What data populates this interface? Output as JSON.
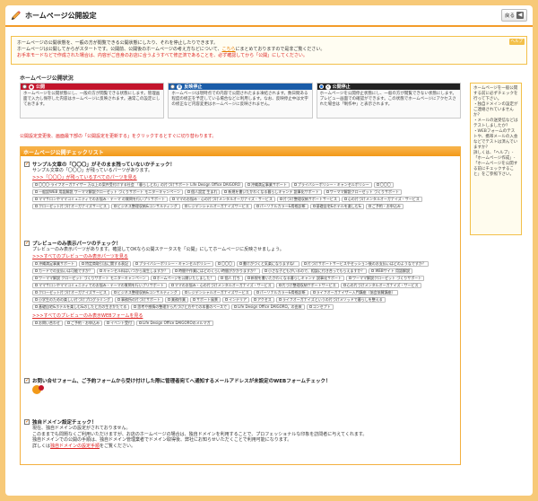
{
  "header": {
    "title": "ホームページ公開設定",
    "back_label": "戻る"
  },
  "info": {
    "line1": "ホームページの公開状態を、一般の方が閲覧できる公開状態にしたり、それを停止したりできます。",
    "line2_before": "ホームページは公開してからがスタートです。公開前、公開後のホームページの考え方などについて、",
    "line2_link": "こちら",
    "line2_after": "にまとめておりますので是非ご覧ください。",
    "line3": "お手本モードなどで作成された場合は、内容がご自身のお店に合うようすべて修正済であることを、必ず確認してから「公開」にしてください。",
    "help_label": "ヘルプ"
  },
  "status": {
    "title": "ホームページ公開状況",
    "cards": [
      {
        "label": "公開",
        "color": "#c3152c",
        "desc": "ホームページを公開状態にし、一般の方が閲覧できる状態にします。管理画面で入力し保存した内容はホームページに反映されます。通常この設定にしておきます。"
      },
      {
        "label": "反映停止",
        "color": "#1a5ca8",
        "desc": "ホームページは現時点での内容で公開されたまま凍結されます。数日間ある程度の修正を予定している場合などに利用します。なお、反映停止中は文字の修正など内容変更はホームページに反映されません。"
      },
      {
        "label": "公開停止",
        "color": "#222222",
        "desc": "ホームページを公開停止状態にし、一般の方が閲覧できない状態にします。プレビュー画面での確認ができます。この状態でホームページにアクセスされた場合は「制作中」と表示されます。"
      }
    ]
  },
  "right_note": "ホームページを一般公開する前に必ずチェックを行って下さい。\n・独自ドメインの設定がご連絡されていませんか？\n・メールの送受信などはテストしましたか？\n・WEBフォームのテストや、携帯メールの入会などでテストは済んでいますか？\n詳しくは、「ヘルプ」-「ホームページ作成」-「ホームページを公開する前にチェックすること」をご参照下さい。",
  "notice": "公開設定変更後、画面最下部の「公開設定を更新する」をクリックするとすぐに切り替わります。",
  "checklist": {
    "title": "ホームページ公開チェックリスト",
    "s1": {
      "heading": "サンプル文章の「〇〇〇」がそのまま残っていないかチェック！",
      "sub": "サンプル文章の「〇〇〇」が残っているパーツがあります。",
      "link": ">>>「〇〇〇」が残っているすべてのパーツを見る",
      "tags": [
        "〇〇〇-ライフオーガナイザー 万以上の案件受付けする社会 「暮らしとわ」の片づけサポート Life Design Office DAIGORO",
        "沖縄満足事業サポート",
        "プライバシーポリシー・キャンセルポリシー",
        "〇〇〇",
        "一般設WEB 用語解説 ワーママ解説クローゼット づくりサポート モニターキャンペーン",
        "個人設定 生まれ",
        "新規を書いたかわくなる暮らしキャンテ 説事化サポート",
        "ワーママ解説クローゼット づくりサポート",
        "ママサロンやママコミュニティでのお悩み・テーマ の質問を行いプリサポート",
        "ママのお悩み・心の片づけメンタルオーガナイズ・サービス",
        "片づけ整理収納サポートサービス",
        "心の片づけメンタルオーガナイズ・サービス",
        "クローゼット片づけオーガナイズサービス",
        "ビジネス整理収納&コンサルティング",
        "レジデンシャルオーガナイズサービス",
        "パーソナルカラー&骨格診断",
        "基礎自宅&ホテルを楽しむ&"
      ],
      "last": "ご予約・お申込み"
    },
    "s2": {
      "heading": "プレビューのみ表示パーツのチェック！",
      "sub": "プレビューのみ表示パーツがあります。確認してOKなら公開ステータスを「公開」にしてホームページに反映させましょう。",
      "link": ">>>すべてのプレビューのみ表示パーツを見る",
      "tags": [
        "沖縄満足事業サポート",
        "特定商取引法に関する表記",
        "プライバシーポリシー・キャンセルポリシー",
        "〇〇〇",
        "書けがづくと気楽になりますね！",
        "片づけサポートサービスやセッション後のお支払いはどのようなですか？",
        "カードでの支払いは可能ですか？",
        "キャンセル料はいつから発生しますか？",
        "時間や作業にはどのくらい時間がかかりますか？",
        "小さな子どもがいるので、相談に付き合ってもらえますか？",
        "WEBサイト 用語解説",
        "ワーママ解説 クローゼット づくりサポート モニターキャンペーン",
        "ホームページを公開いたしました！",
        "個人 打ち",
        "新規を書いたかわくなる暮らしキャンテ 説事化サポート",
        "ワーママ解説クローゼット づくりサポート",
        "ママサロンやママコミュニティでのお悩み・テーマの質問を行いプリサポート",
        "ママのお悩み・心の片づけメンタルオーガナイズ・サービス",
        "片づけ整理収納サポートサービス",
        "心の片づけメンタルオーガナイズ・サービス",
        "クローゼット片づけオーガナイズサービス",
        "ビジネス整理収納&コンサルティング",
        "レジデンシャルオーガナイズサービス",
        "パーソナルカラー&骨格診断",
        "ライフオーガナイザー入門講座（協会協賛講座）",
        "小学生のための楽しい片づけプログラミング",
        "事務所の片づけサポート",
        "業務作業",
        "サポート風景",
        "インテリア",
        "アクセス",
        "ライフオーガナイズというの片づけメソッドで暮らしを整える",
        "基礎自宅&ホテルを楽しむ&のしたと方の生きかたてる",
        "思考や感情の整理から片づけと方やての本番のベースで",
        "Life Design Office DAIGORO。の由来",
        "コンセプト"
      ]
    },
    "s2b": {
      "link": ">>>すべてのプレビューのみ表示WEBフォームを見る",
      "tags": [
        "お問い合わせ",
        "ご予約・お申込み",
        "イベント受付",
        "Life Design Office DAIGOROのメルマガ"
      ]
    },
    "s3": {
      "heading": "お問い合せフォーム、ご予約フォームから受け付けした際に管理者宛てへ通知するメールアドレスが未設定のWEBフォームチェック！"
    },
    "s4": {
      "heading": "独自ドメイン設定チェック！",
      "l1": "現在、独自ドメインの設定がされておりません。",
      "l2": "このままでも問題なくご利用いただけますが、お店のホームページの場合は、独自ドメインを利用することで、プロフェッショナルな印象を訪問者に与えてくれます。",
      "l3": "独自ドメインでの公開の手順は、独自ドメイン管理業者でドメイン取得後、弊社にお知らせいただくことで利用可能になります。",
      "l4_before": "詳しくは",
      "l4_link": "独自ドメインの設定手順",
      "l4_after": "をご覧ください。"
    }
  }
}
